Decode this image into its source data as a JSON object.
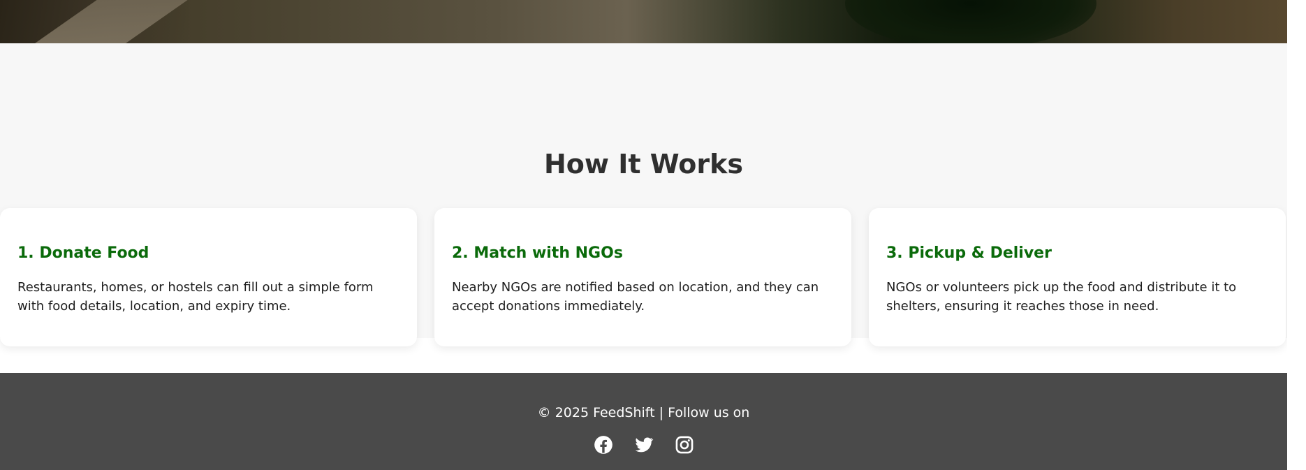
{
  "how_it_works": {
    "title": "How It Works",
    "steps": [
      {
        "title": "1. Donate Food",
        "text": "Restaurants, homes, or hostels can fill out a simple form with food details, location, and expiry time."
      },
      {
        "title": "2. Match with NGOs",
        "text": "Nearby NGOs are notified based on location, and they can accept donations immediately."
      },
      {
        "title": "3. Pickup & Deliver",
        "text": "NGOs or volunteers pick up the food and distribute it to shelters, ensuring it reaches those in need."
      }
    ]
  },
  "footer": {
    "text": "© 2025 FeedShift | Follow us on",
    "social": [
      {
        "name": "facebook-icon"
      },
      {
        "name": "twitter-icon"
      },
      {
        "name": "instagram-icon"
      }
    ]
  },
  "colors": {
    "accent_green": "#0a6a0a",
    "section_bg": "#f7f7f7",
    "footer_bg": "#4a4a4a",
    "heading": "#2f2f2f"
  }
}
